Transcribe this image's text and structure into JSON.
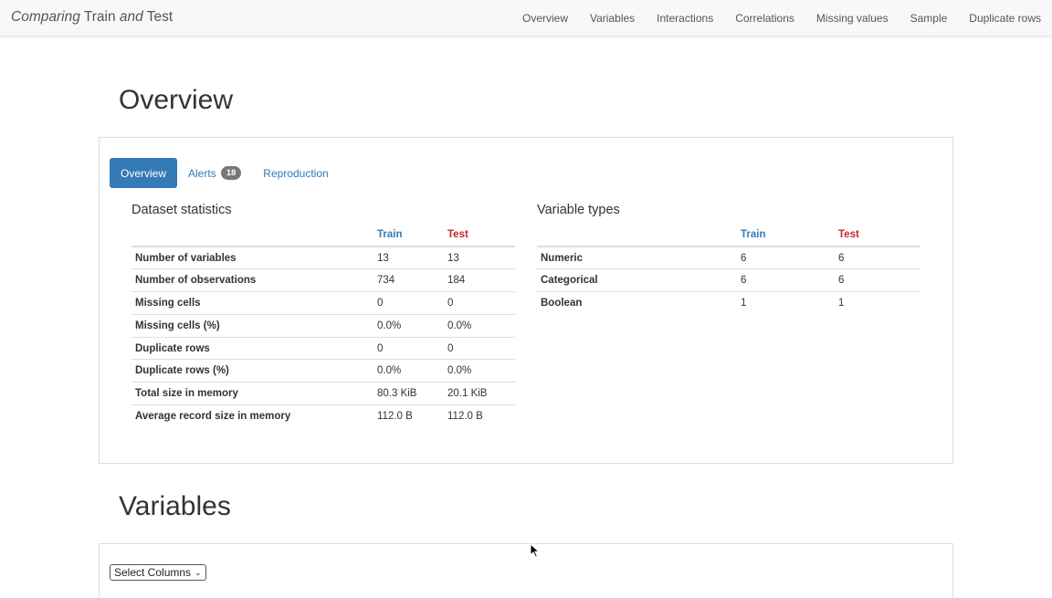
{
  "navbar": {
    "brand_italic": "Comparing",
    "brand_middle": " Train ",
    "brand_italic2": "and",
    "brand_end": " Test",
    "links": [
      "Overview",
      "Variables",
      "Interactions",
      "Correlations",
      "Missing values",
      "Sample",
      "Duplicate rows"
    ]
  },
  "overview": {
    "title": "Overview",
    "tabs": {
      "overview": "Overview",
      "alerts": "Alerts",
      "alerts_count": "18",
      "reproduction": "Reproduction"
    },
    "dataset_statistics": {
      "title": "Dataset statistics",
      "col_train": "Train",
      "col_test": "Test",
      "rows": [
        {
          "label": "Number of variables",
          "train": "13",
          "test": "13"
        },
        {
          "label": "Number of observations",
          "train": "734",
          "test": "184"
        },
        {
          "label": "Missing cells",
          "train": "0",
          "test": "0"
        },
        {
          "label": "Missing cells (%)",
          "train": "0.0%",
          "test": "0.0%"
        },
        {
          "label": "Duplicate rows",
          "train": "0",
          "test": "0"
        },
        {
          "label": "Duplicate rows (%)",
          "train": "0.0%",
          "test": "0.0%"
        },
        {
          "label": "Total size in memory",
          "train": "80.3 KiB",
          "test": "20.1 KiB"
        },
        {
          "label": "Average record size in memory",
          "train": "112.0 B",
          "test": "112.0 B"
        }
      ]
    },
    "variable_types": {
      "title": "Variable types",
      "col_train": "Train",
      "col_test": "Test",
      "rows": [
        {
          "label": "Numeric",
          "train": "6",
          "test": "6"
        },
        {
          "label": "Categorical",
          "train": "6",
          "test": "6"
        },
        {
          "label": "Boolean",
          "train": "1",
          "test": "1"
        }
      ]
    }
  },
  "variables": {
    "title": "Variables",
    "select_columns": "Select Columns"
  },
  "colors": {
    "train": "#337ab7",
    "test": "#c0272d",
    "active_tab": "#337ab7"
  }
}
